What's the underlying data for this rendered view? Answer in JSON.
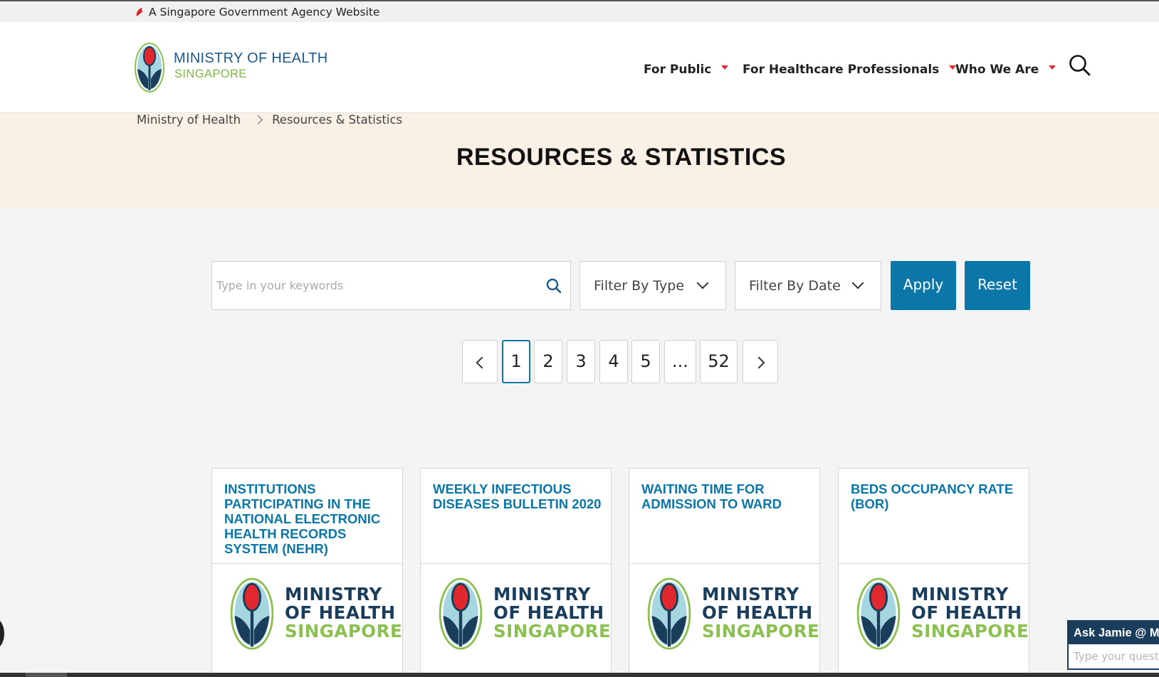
{
  "masthead": {
    "text": "A Singapore Government Agency Website"
  },
  "logo": {
    "line1": "MINISTRY OF HEALTH",
    "line2": "SINGAPORE"
  },
  "nav": [
    {
      "label": "For Public"
    },
    {
      "label": "For Healthcare Professionals"
    },
    {
      "label": "Who We Are"
    }
  ],
  "breadcrumb": [
    "Ministry of Health",
    "Resources & Statistics"
  ],
  "page_title": "RESOURCES & STATISTICS",
  "filters": {
    "keyword_placeholder": "Type in your keywords",
    "type_label": "Filter By Type",
    "date_label": "Filter By Date",
    "apply_label": "Apply",
    "reset_label": "Reset"
  },
  "pagination": {
    "pages": [
      "1",
      "2",
      "3",
      "4",
      "5",
      "...",
      "52"
    ],
    "current": "1"
  },
  "cards": [
    {
      "title": "INSTITUTIONS PARTICIPATING IN THE NATIONAL ELECTRONIC HEALTH RECORDS SYSTEM (NEHR)"
    },
    {
      "title": "WEEKLY INFECTIOUS DISEASES BULLETIN 2020"
    },
    {
      "title": "WAITING TIME FOR ADMISSION TO WARD"
    },
    {
      "title": "BEDS OCCUPANCY RATE (BOR)"
    }
  ],
  "card_logo": {
    "line1": "MINISTRY",
    "line2": "OF HEALTH",
    "line3": "SINGAPORE"
  },
  "chat": {
    "title": "Ask Jamie @ M",
    "placeholder": "Type your questi"
  },
  "colors": {
    "accent": "#0b76a8",
    "brand_navy": "#1a3d5c",
    "brand_green": "#8cc152",
    "caret_red": "#e0282e",
    "banner_bg": "#faf1e6"
  }
}
